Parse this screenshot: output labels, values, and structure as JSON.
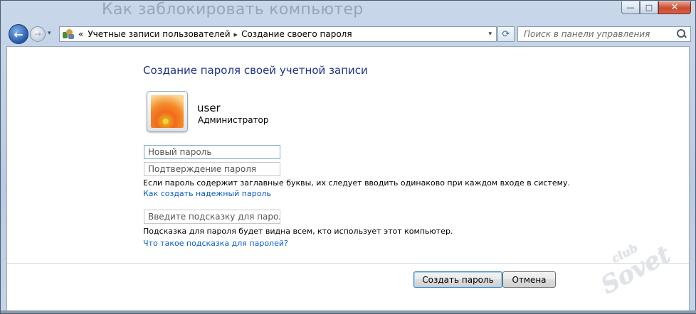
{
  "window": {
    "title": "Как заблокировать компьютер",
    "controls": {
      "minimize": "—",
      "maximize": "□",
      "close": "✕"
    }
  },
  "nav": {
    "back_glyph": "←",
    "forward_glyph": "→",
    "history_dropdown_glyph": "▾",
    "breadcrumb_prefix": "«",
    "breadcrumbs": [
      "Учетные записи пользователей",
      "Создание своего пароля"
    ],
    "separator": "▸",
    "address_dropdown_glyph": "▾",
    "refresh_glyph": "⟳",
    "search_placeholder": "Поиск в панели управления"
  },
  "main": {
    "heading": "Создание пароля своей учетной записи",
    "user": {
      "name": "user",
      "role": "Администратор"
    },
    "fields": {
      "new_password_placeholder": "Новый пароль",
      "confirm_password_placeholder": "Подтверждение пароля",
      "hint_placeholder": "Введите подсказку для пароля"
    },
    "case_warning": "Если пароль содержит заглавные буквы, их следует вводить одинаково при каждом входе в систему.",
    "strong_password_link": "Как создать надежный пароль",
    "hint_note": "Подсказка для пароля будет видна всем, кто использует этот компьютер.",
    "hint_link": "Что такое подсказка для паролей?"
  },
  "buttons": {
    "create": "Создать пароль",
    "cancel": "Отмена"
  },
  "watermark": {
    "line1": "club",
    "line2": "Sovet"
  },
  "colors": {
    "heading": "#1e3287",
    "link": "#0a5cc5",
    "close_button": "#c94a2f",
    "frame": "#b9cbe3"
  },
  "icons": [
    "back-arrow-icon",
    "forward-arrow-icon",
    "control-panel-icon",
    "refresh-icon",
    "search-icon",
    "user-avatar-flower"
  ]
}
